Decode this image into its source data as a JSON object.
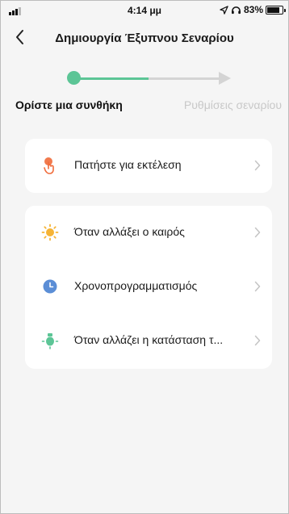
{
  "status_bar": {
    "time": "4:14 μμ",
    "battery_text": "83%",
    "battery_level": 0.83
  },
  "nav": {
    "back_icon": "chevron-left-icon",
    "title": "Δημιουργία Έξυπνου Σεναρίου"
  },
  "stepper": {
    "current_step": 1,
    "total_steps": 2,
    "step1_label": "Ορίστε μια συνθήκη",
    "step2_label": "Ρυθμίσεις σεναρίου",
    "active_color": "#5cc596",
    "inactive_color": "#d4d4d4"
  },
  "conditions": {
    "group1": [
      {
        "icon": "hand-tap-icon",
        "icon_color": "#f06b3a",
        "label": "Πατήστε για εκτέλεση"
      }
    ],
    "group2": [
      {
        "icon": "sun-weather-icon",
        "icon_color": "#f5b335",
        "label": "Όταν αλλάξει ο καιρός"
      },
      {
        "icon": "clock-icon",
        "icon_color": "#5b8ed6",
        "label": "Χρονοπρογραμματισμός"
      },
      {
        "icon": "device-status-icon",
        "icon_color": "#5cc596",
        "label": "Όταν αλλάζει η κατάσταση τ..."
      }
    ]
  }
}
